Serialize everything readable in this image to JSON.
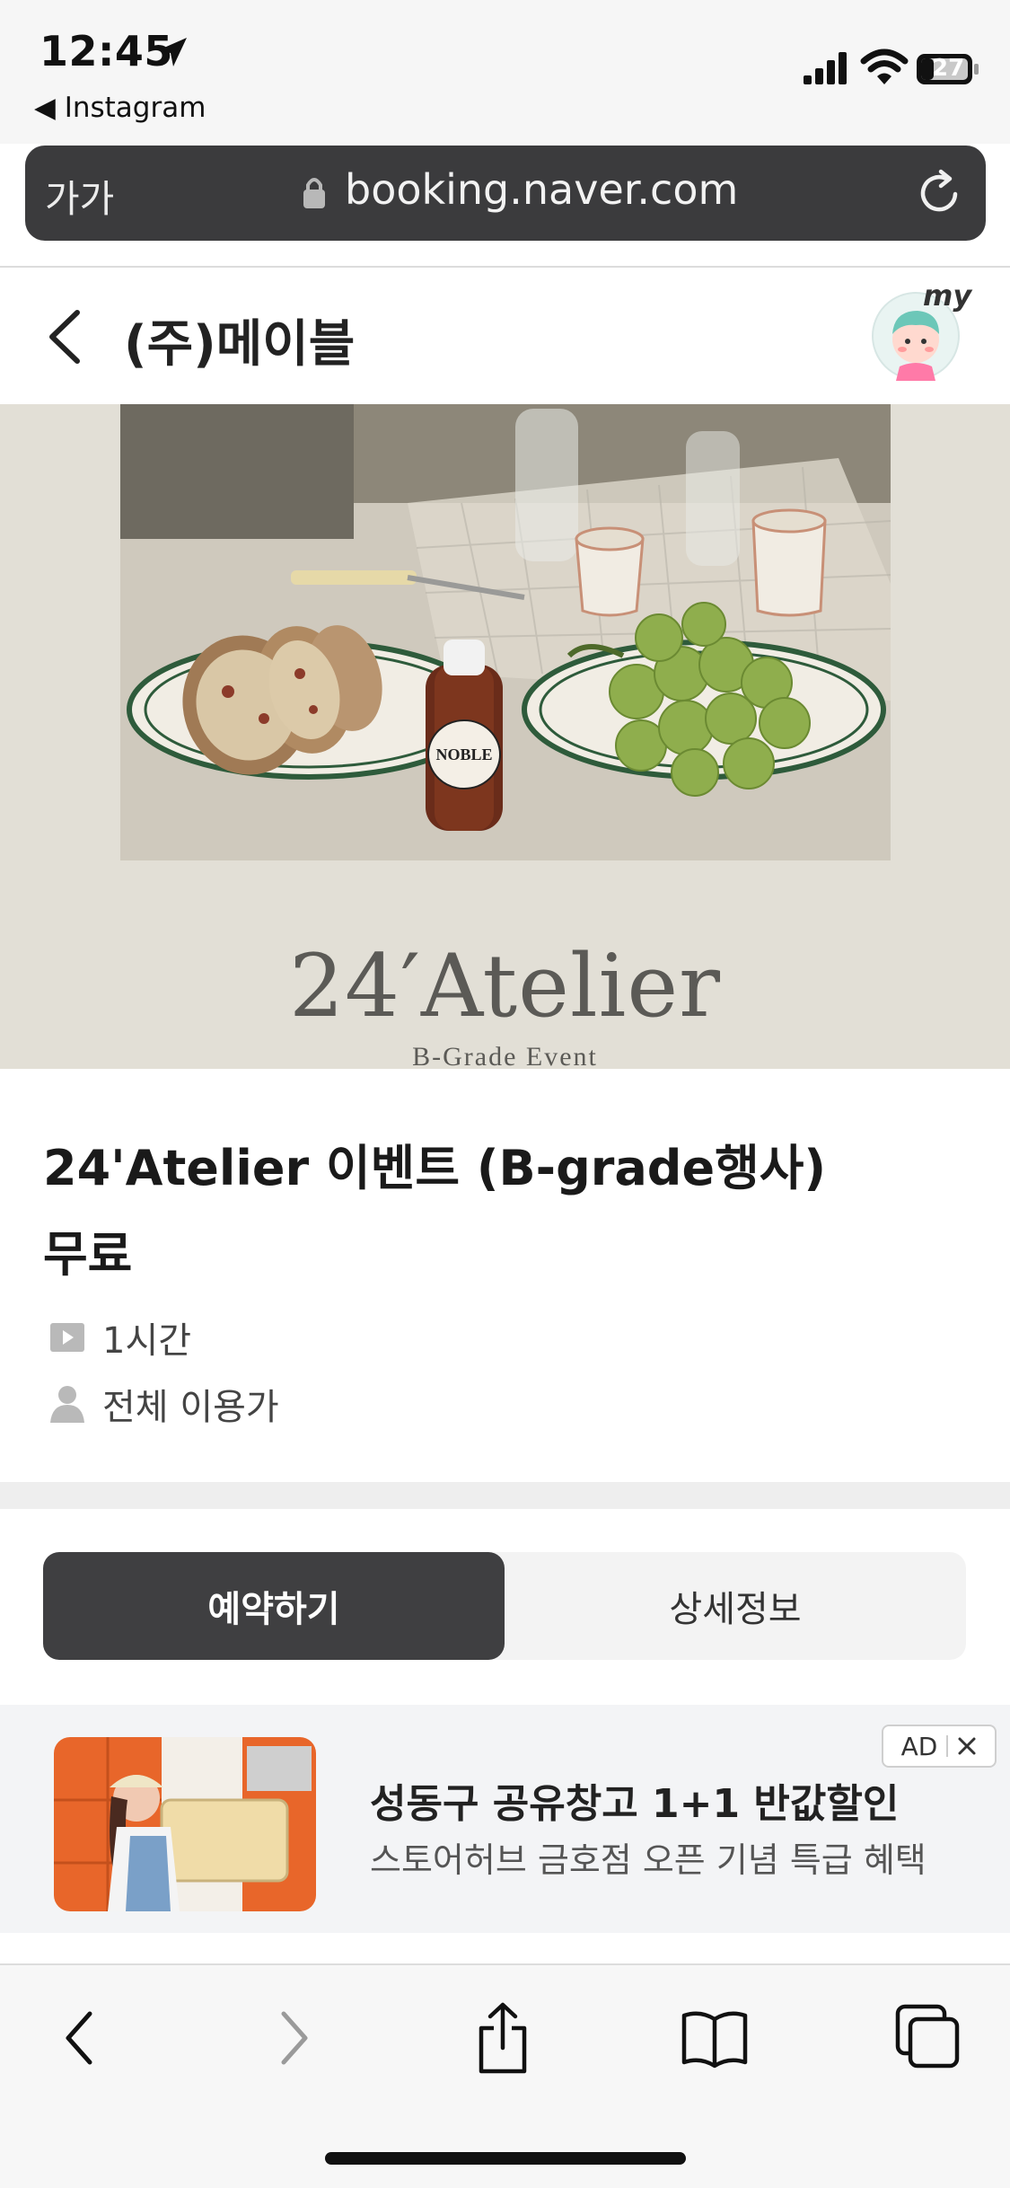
{
  "status_bar": {
    "time": "12:45",
    "back_app": "◀ Instagram",
    "battery": "27"
  },
  "address_bar": {
    "text_size_label": "가가",
    "domain": "booking.naver.com"
  },
  "header": {
    "title": "(주)메이블",
    "avatar_label": "my"
  },
  "hero": {
    "brand_title": "24′Atelier",
    "brand_subtitle": "B-Grade Event",
    "bottle_label": "NOBLE"
  },
  "event": {
    "title": "24'Atelier 이벤트 (B-grade행사)",
    "price": "무료",
    "duration": "1시간",
    "audience": "전체 이용가"
  },
  "tabs": [
    {
      "label": "예약하기",
      "active": true
    },
    {
      "label": "상세정보",
      "active": false
    }
  ],
  "ad": {
    "badge": "AD",
    "title": "성동구 공유창고 1+1 반값할인",
    "subtitle": "스토어허브 금호점 오픈 기념 특급 혜택"
  },
  "colors": {
    "accent_dark": "#3f3f41",
    "address_bar": "#3b3b3d",
    "hero_bg": "#e2dfd6"
  }
}
